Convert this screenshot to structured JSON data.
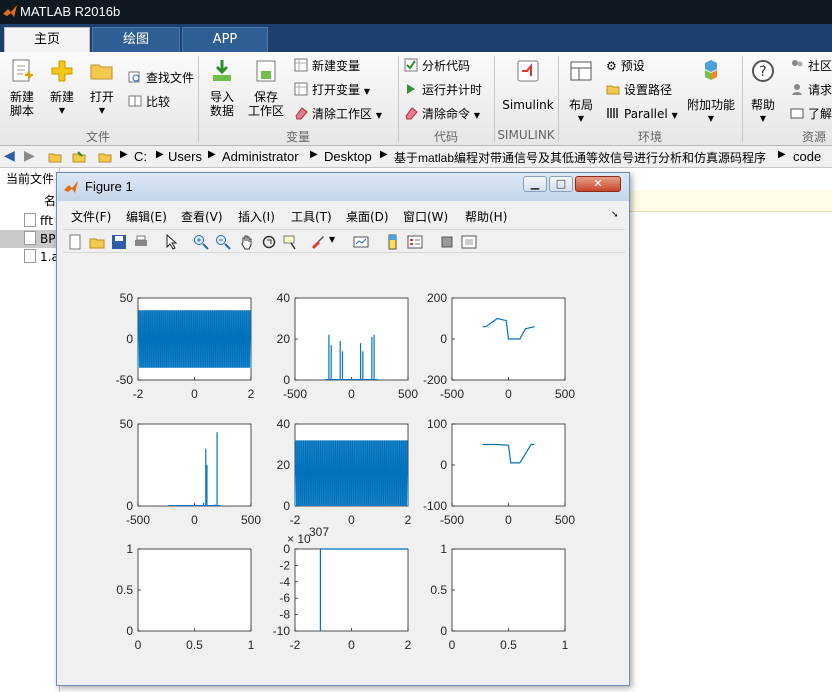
{
  "app": {
    "title": "MATLAB R2016b"
  },
  "tabs": [
    {
      "label": "主页"
    },
    {
      "label": "绘图"
    },
    {
      "label": "APP"
    }
  ],
  "ribbon": {
    "new_script": "新建\n脚本",
    "new": "新建",
    "open": "打开",
    "find_files": "查找文件",
    "compare": "比较",
    "import": "导入\n数据",
    "save_ws": "保存\n工作区",
    "new_var": "新建变量",
    "open_var": "打开变量",
    "clear_ws": "清除工作区",
    "analyze": "分析代码",
    "run_time": "运行并计时",
    "clear_cmd": "清除命令",
    "simulink": "Simulink",
    "layout": "布局",
    "prefs": "预设",
    "set_path": "设置路径",
    "parallel": "Parallel",
    "addons": "附加功能",
    "help": "帮助",
    "community": "社区",
    "request": "请求",
    "learn": "了解",
    "groups": {
      "file": "文件",
      "variable": "变量",
      "code": "代码",
      "simulink": "SIMULINK",
      "env": "环境",
      "resources": "资源"
    }
  },
  "address": {
    "segments": [
      "C:",
      "Users",
      "Administrator",
      "Desktop",
      "基于matlab编程对带通信号及其低通等效信号进行分析和仿真源码程序",
      "code"
    ]
  },
  "left_pane": {
    "header": "当前文件",
    "col": "名",
    "files": [
      "fft",
      "BP",
      "1.a"
    ]
  },
  "figure": {
    "title": "Figure 1",
    "menu": [
      "文件(F)",
      "编辑(E)",
      "查看(V)",
      "插入(I)",
      "工具(T)",
      "桌面(D)",
      "窗口(W)",
      "帮助(H)"
    ]
  },
  "chart_data": [
    {
      "type": "line",
      "subplot": 1,
      "xlim": [
        -2,
        2
      ],
      "ylim": [
        -50,
        50
      ],
      "xticks": [
        "-2",
        "0",
        "2"
      ],
      "yticks": [
        "-50",
        "0",
        "50"
      ],
      "series": [
        {
          "values_description_amplitude": 35
        }
      ]
    },
    {
      "type": "line",
      "subplot": 2,
      "xlim": [
        -500,
        500
      ],
      "ylim": [
        0,
        40
      ],
      "xticks": [
        "-500",
        "0",
        "500"
      ],
      "yticks": [
        "0",
        "20",
        "40"
      ],
      "series": [
        {
          "x": [
            -200,
            -180,
            -100,
            -80,
            80,
            100,
            180,
            200
          ],
          "y": [
            22,
            17,
            19,
            14,
            18,
            14,
            21,
            22
          ]
        }
      ]
    },
    {
      "type": "line",
      "subplot": 3,
      "xlim": [
        -500,
        500
      ],
      "ylim": [
        -200,
        200
      ],
      "xticks": [
        "-500",
        "0",
        "500"
      ],
      "yticks": [
        "-200",
        "0",
        "200"
      ],
      "series": [
        {
          "x": [
            -230,
            -200,
            -100,
            -20,
            0,
            100,
            150,
            230
          ],
          "y": [
            60,
            60,
            100,
            90,
            0,
            0,
            50,
            60
          ]
        }
      ]
    },
    {
      "type": "line",
      "subplot": 4,
      "xlim": [
        -500,
        500
      ],
      "ylim": [
        0,
        50
      ],
      "xticks": [
        "-500",
        "0",
        "500"
      ],
      "yticks": [
        "0",
        "50"
      ],
      "series": [
        {
          "x": [
            0,
            80,
            100,
            110,
            180,
            200,
            230
          ],
          "y": [
            0,
            2,
            35,
            25,
            1,
            45,
            0
          ]
        }
      ]
    },
    {
      "type": "line",
      "subplot": 5,
      "xlim": [
        -2,
        2
      ],
      "ylim": [
        0,
        40
      ],
      "xticks": [
        "-2",
        "0",
        "2"
      ],
      "yticks": [
        "0",
        "20",
        "40"
      ],
      "series": [
        {
          "amplitude": 32
        }
      ]
    },
    {
      "type": "line",
      "subplot": 6,
      "xlim": [
        -500,
        500
      ],
      "ylim": [
        -100,
        100
      ],
      "xticks": [
        "-500",
        "0",
        "500"
      ],
      "yticks": [
        "-100",
        "0",
        "100"
      ],
      "series": [
        {
          "x": [
            -230,
            -100,
            0,
            20,
            100,
            200,
            230
          ],
          "y": [
            50,
            50,
            48,
            5,
            5,
            50,
            50
          ]
        }
      ]
    },
    {
      "type": "line",
      "subplot": 7,
      "xlim": [
        0,
        1
      ],
      "ylim": [
        0,
        1
      ],
      "xticks": [
        "0",
        "0.5",
        "1"
      ],
      "yticks": [
        "0",
        "0.5",
        "1"
      ],
      "series": []
    },
    {
      "type": "line",
      "subplot": 8,
      "xlim": [
        -2,
        2
      ],
      "ylim": [
        -10,
        0
      ],
      "xticks": [
        "-2",
        "0",
        "2"
      ],
      "yticks": [
        "-10",
        "-8",
        "-6",
        "-4",
        "-2",
        "0"
      ],
      "multiplier": "× 10",
      "exponent": "307",
      "series": [
        {
          "x": [
            -1.1,
            -1.1,
            2
          ],
          "y": [
            -10,
            0,
            0
          ]
        }
      ]
    },
    {
      "type": "line",
      "subplot": 9,
      "xlim": [
        0,
        1
      ],
      "ylim": [
        0,
        1
      ],
      "xticks": [
        "0",
        "0.5",
        "1"
      ],
      "yticks": [
        "0",
        "0.5",
        "1"
      ],
      "series": []
    }
  ],
  "colors": {
    "accent": "#0072bd",
    "ribbon_blue": "#1c3f6e"
  }
}
